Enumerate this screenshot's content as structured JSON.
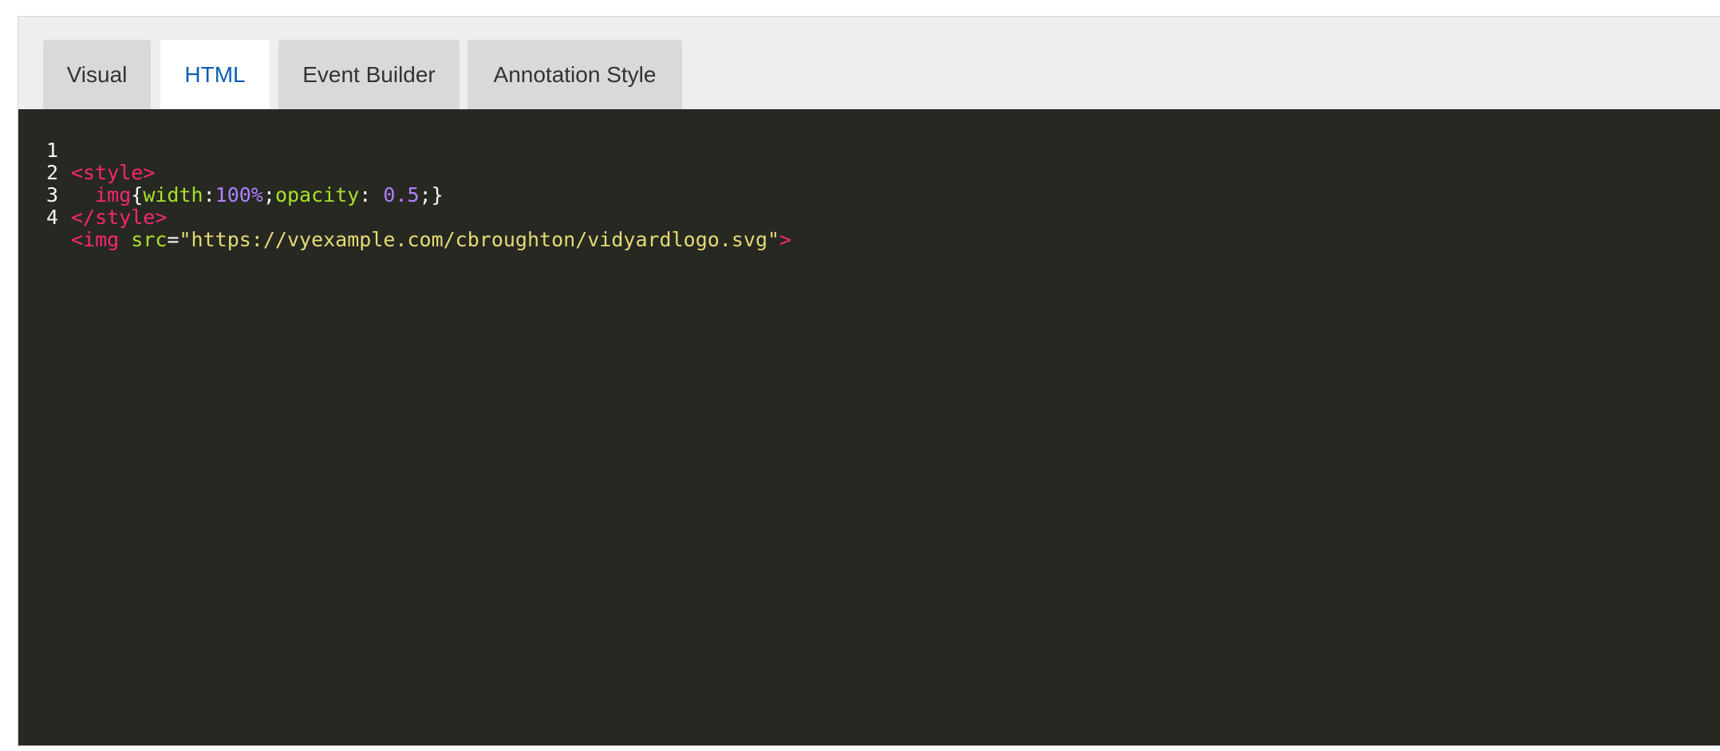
{
  "tabs": [
    {
      "label": "Visual",
      "active": false
    },
    {
      "label": "HTML",
      "active": true
    },
    {
      "label": "Event Builder",
      "active": false
    },
    {
      "label": "Annotation Style",
      "active": false
    }
  ],
  "editor": {
    "theme_colors": {
      "background": "#272822",
      "tag": "#f92672",
      "attribute": "#a6e22e",
      "string": "#e6db74",
      "number": "#ae81ff",
      "text": "#f8f8f2"
    },
    "line_numbers": [
      "1",
      "2",
      "3",
      "4"
    ],
    "lines": {
      "l1": {
        "open": "<style>"
      },
      "l2": {
        "indent": "  ",
        "selector": "img",
        "brace_open": "{",
        "prop1": "width",
        "colon1": ":",
        "val1": "100%",
        "semi1": ";",
        "prop2": "opacity",
        "colon2": ": ",
        "val2": "0.5",
        "semi2": ";",
        "brace_close": "}"
      },
      "l3": {
        "close": "</style>"
      },
      "l4": {
        "tag_open": "<img",
        "space": " ",
        "attr": "src",
        "eq": "=",
        "value": "\"https://vyexample.com/cbroughton/vidyardlogo.svg\"",
        "tag_end": ">"
      }
    }
  }
}
